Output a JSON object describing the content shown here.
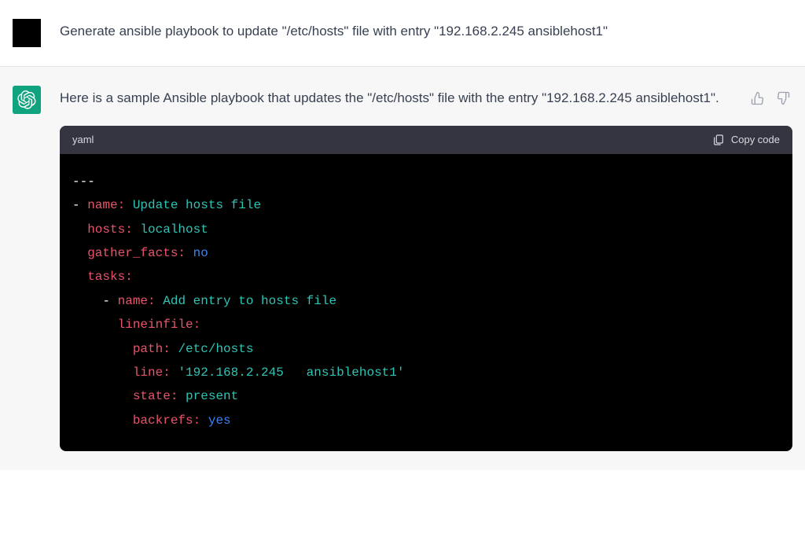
{
  "user": {
    "text": "Generate ansible playbook to update \"/etc/hosts\" file with entry \"192.168.2.245 ansiblehost1\""
  },
  "assistant": {
    "text": "Here is a sample Ansible playbook that updates the \"/etc/hosts\" file with the entry \"192.168.2.245 ansiblehost1\".",
    "code_lang": "yaml",
    "copy_label": "Copy code",
    "code": {
      "line1_dashes": "---",
      "line2_key": "name:",
      "line2_val": "Update hosts file",
      "line3_key": "hosts:",
      "line3_val": "localhost",
      "line4_key": "gather_facts:",
      "line4_val": "no",
      "line5_key": "tasks:",
      "line6_key": "name:",
      "line6_val": "Add entry to hosts file",
      "line7_key": "lineinfile:",
      "line8_key": "path:",
      "line8_val": "/etc/hosts",
      "line9_key": "line:",
      "line9_val": "'192.168.2.245   ansiblehost1'",
      "line10_key": "state:",
      "line10_val": "present",
      "line11_key": "backrefs:",
      "line11_val": "yes"
    }
  }
}
